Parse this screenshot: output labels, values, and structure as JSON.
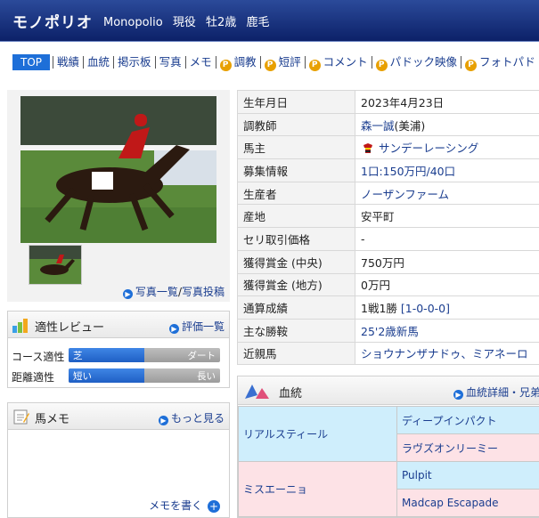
{
  "header": {
    "name": "モノポリオ",
    "romaji": "Monopolio",
    "status": "現役",
    "sex_age": "牡2歳",
    "color": "鹿毛"
  },
  "nav": {
    "items": [
      "TOP",
      "戦績",
      "血統",
      "掲示板",
      "写真",
      "メモ",
      "調教",
      "短評",
      "コメント",
      "パドック映像",
      "フォトパド"
    ]
  },
  "photo": {
    "list_label": "写真一覧",
    "post_label": "写真投稿",
    "separator": "/"
  },
  "aptitude": {
    "title": "適性レビュー",
    "link": "評価一覧",
    "course": {
      "label": "コース適性",
      "left": "芝",
      "right": "ダート",
      "value": 0.5
    },
    "distance": {
      "label": "距離適性",
      "left": "短い",
      "right": "長い",
      "value": 0.5
    }
  },
  "memo": {
    "title": "馬メモ",
    "more": "もっと見る",
    "write": "メモを書く"
  },
  "info": {
    "rows": [
      {
        "k": "生年月日",
        "v": "2023年4月23日"
      },
      {
        "k": "調教師",
        "v": "森一誠",
        "v2": "(美浦)"
      },
      {
        "k": "馬主",
        "v": "サンデーレーシング"
      },
      {
        "k": "募集情報",
        "v": "1口:150万円/40口"
      },
      {
        "k": "生産者",
        "v": "ノーザンファーム"
      },
      {
        "k": "産地",
        "v": "安平町"
      },
      {
        "k": "セリ取引価格",
        "v": "-"
      },
      {
        "k": "獲得賞金 (中央)",
        "v": "750万円"
      },
      {
        "k": "獲得賞金 (地方)",
        "v": "0万円"
      },
      {
        "k": "通算成績",
        "v": "1戦1勝",
        "v2": "[1-0-0-0]"
      },
      {
        "k": "主な勝鞍",
        "v": "25'2歳新馬"
      },
      {
        "k": "近親馬",
        "v": "ショウナンザナドゥ、ミアネーロ"
      }
    ]
  },
  "pedigree": {
    "title": "血統",
    "link": "血統詳細・兄弟",
    "sire": "リアルスティール",
    "sire_sire": "ディープインパクト",
    "sire_dam": "ラヴズオンリーミー",
    "dam": "ミスエーニョ",
    "dam_sire": "Pulpit",
    "dam_dam": "Madcap Escapade"
  }
}
